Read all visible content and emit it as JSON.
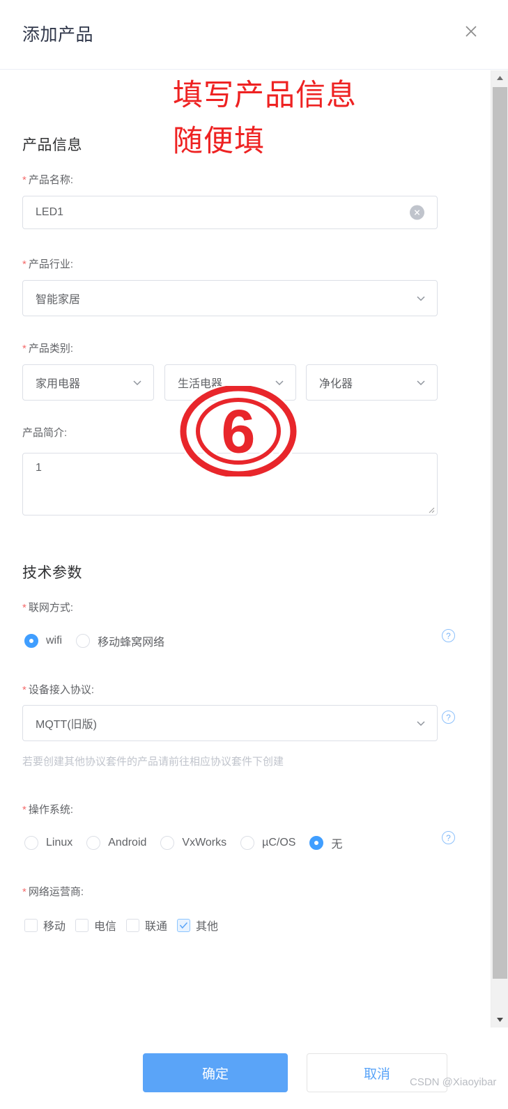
{
  "dialog": {
    "title": "添加产品",
    "close_icon": "close-icon"
  },
  "annotations": {
    "note_line1": "填写产品信息",
    "note_line2": "随便填",
    "step_badge": "6"
  },
  "product_info": {
    "section_title": "产品信息",
    "name": {
      "label": "产品名称:",
      "required": "*",
      "value": "LED1",
      "clear_icon": "circle-close-icon"
    },
    "industry": {
      "label": "产品行业:",
      "required": "*",
      "value": "智能家居"
    },
    "category": {
      "label": "产品类别:",
      "required": "*",
      "values": [
        "家用电器",
        "生活电器",
        "净化器"
      ]
    },
    "intro": {
      "label": "产品简介:",
      "value": "1"
    }
  },
  "tech_params": {
    "section_title": "技术参数",
    "network_mode": {
      "label": "联网方式:",
      "required": "*",
      "options": [
        {
          "label": "wifi",
          "checked": true
        },
        {
          "label": "移动蜂窝网络",
          "checked": false
        }
      ],
      "help_icon": "question-circle-icon"
    },
    "access_protocol": {
      "label": "设备接入协议:",
      "required": "*",
      "value": "MQTT(旧版)",
      "help_icon": "question-circle-icon",
      "hint": "若要创建其他协议套件的产品请前往相应协议套件下创建"
    },
    "operating_system": {
      "label": "操作系统:",
      "required": "*",
      "options": [
        {
          "label": "Linux",
          "checked": false
        },
        {
          "label": "Android",
          "checked": false
        },
        {
          "label": "VxWorks",
          "checked": false
        },
        {
          "label": "µC/OS",
          "checked": false
        },
        {
          "label": "无",
          "checked": true
        }
      ],
      "help_icon": "question-circle-icon"
    },
    "network_operator": {
      "label": "网络运营商:",
      "required": "*",
      "options": [
        {
          "label": "移动",
          "checked": false
        },
        {
          "label": "电信",
          "checked": false
        },
        {
          "label": "联通",
          "checked": false
        },
        {
          "label": "其他",
          "checked": true
        }
      ]
    }
  },
  "footer": {
    "confirm_label": "确定",
    "cancel_label": "取消",
    "watermark": "CSDN @Xiaoyibar"
  },
  "colors": {
    "primary": "#5aa4f8",
    "required": "#f56c6c",
    "annotation": "#ee2222",
    "border": "#dcdfe6"
  }
}
